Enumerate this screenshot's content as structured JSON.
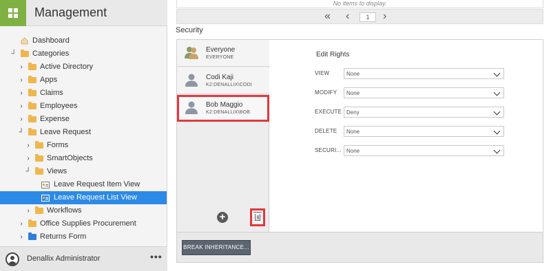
{
  "app": {
    "title": "Management"
  },
  "tree": [
    {
      "label": "Dashboard",
      "type": "house"
    },
    {
      "label": "Categories",
      "type": "folder",
      "expanded": true
    },
    {
      "label": "Active Directory",
      "type": "folder"
    },
    {
      "label": "Apps",
      "type": "folder"
    },
    {
      "label": "Claims",
      "type": "folder"
    },
    {
      "label": "Employees",
      "type": "folder"
    },
    {
      "label": "Expense",
      "type": "folder"
    },
    {
      "label": "Leave Request",
      "type": "folder",
      "expanded": true
    },
    {
      "label": "Forms",
      "type": "folder"
    },
    {
      "label": "SmartObjects",
      "type": "folder"
    },
    {
      "label": "Views",
      "type": "folder",
      "expanded": true
    },
    {
      "label": "Leave Request Item View",
      "type": "view"
    },
    {
      "label": "Leave Request List View",
      "type": "view",
      "selected": true
    },
    {
      "label": "Workflows",
      "type": "folder"
    },
    {
      "label": "Office Supplies Procurement",
      "type": "folder"
    },
    {
      "label": "Returns Form",
      "type": "folder-blue"
    }
  ],
  "user_bar": {
    "name": "Denallix Administrator",
    "more": "•••"
  },
  "grid": {
    "empty_text": "No items to display.",
    "page": "1",
    "first_icon": "double-chevron-left-icon",
    "prev_icon": "chevron-left-icon",
    "next_icon": "chevron-right-icon"
  },
  "security": {
    "title": "Security",
    "users": [
      {
        "name": "Everyone",
        "sub": "EVERYONE",
        "icon": "group-icon"
      },
      {
        "name": "Codi Kaji",
        "sub": "K2:DENALLIX\\CODI",
        "icon": "user-icon"
      },
      {
        "name": "Bob Maggio",
        "sub": "K2:DENALLIX\\BOB",
        "icon": "user-icon",
        "selected": true
      }
    ],
    "add_label": "+",
    "rights_title": "Edit Rights",
    "rights": [
      {
        "label": "VIEW",
        "value": "None"
      },
      {
        "label": "MODIFY",
        "value": "None"
      },
      {
        "label": "EXECUTE",
        "value": "Deny"
      },
      {
        "label": "DELETE",
        "value": "None"
      },
      {
        "label": "SECURI...",
        "value": "None"
      }
    ],
    "break_inheritance": "BREAK INHERITANCE...",
    "accent": "#e0383e",
    "brand_green": "#7fb142",
    "selection_blue": "#2c8ae6"
  }
}
